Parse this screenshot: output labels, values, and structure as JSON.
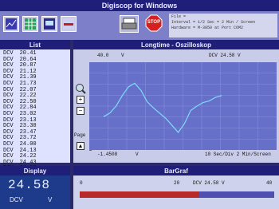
{
  "app": {
    "title": "Digiscop for Windows"
  },
  "info": {
    "file": "File  =",
    "interval": "Interval  =       1/2 Sec = 2 Min / Screen",
    "hardware": "Hardware  =    M-3850   at Port  COM2"
  },
  "toolbar": {
    "stop_label": "STOP"
  },
  "list": {
    "title": "List",
    "unit": "DCV",
    "values": [
      "20.41",
      "20.64",
      "20.87",
      "21.12",
      "21.39",
      "21.73",
      "22.07",
      "22.22",
      "22.50",
      "22.84",
      "23.02",
      "23.13",
      "23.30",
      "23.47",
      "23.72",
      "24.00",
      "24.13",
      "24.22",
      "24.43",
      "24.58"
    ]
  },
  "graph": {
    "title": "Longtime - Oszilloskop",
    "y_top": "40.0",
    "y_top_unit": "V",
    "y_bottom": "-1.4508",
    "y_bottom_unit": "V",
    "readout": "DCV 24.58  V",
    "page_label": "Page",
    "page_num": "2",
    "timebase": "10 Sec/Div  2 Min/Screen"
  },
  "display": {
    "title": "Display",
    "value": "24.58",
    "unit": "DCV",
    "volt": "V"
  },
  "bargraf": {
    "title": "BarGraf",
    "scale_start": "0",
    "scale_mid": "20",
    "scale_end": "40",
    "readout": "DCV  24.58   V",
    "level": 0.6145
  },
  "colors": {
    "trace": "#7fdcff",
    "bar_fill": "#b82a2a",
    "accent": "#1f1f7a"
  }
}
